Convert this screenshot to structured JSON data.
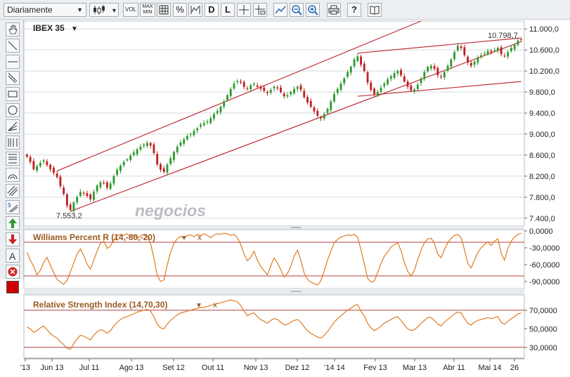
{
  "toolbar": {
    "period": "Diariamente",
    "vol_label": "VOL",
    "max_label": "MAX",
    "min_label": "MIN",
    "pct_label": "%",
    "d_label": "D",
    "l_label": "L",
    "help_label": "?"
  },
  "main_chart": {
    "title": "IBEX 35",
    "title_arrow": "▼",
    "watermark": "negocios",
    "last_value_label": "10.798,7",
    "low_value_label": "7.553,2",
    "y_tick_labels": [
      "11.000,0",
      "10.600,0",
      "10.200,0",
      "9.800,0",
      "9.400,0",
      "9.000,0",
      "8.600,0",
      "8.200,0",
      "7.800,0",
      "7.400,0"
    ],
    "x_tick_labels": [
      "'13",
      "Jun 13",
      "Jul 11",
      "Ago 13",
      "Set 12",
      "Out 11",
      "Nov 13",
      "Dez 12",
      "'14 14",
      "Fev 13",
      "Mar 13",
      "Abr 11",
      "Mai 14",
      "26"
    ],
    "colors": {
      "up": "#2e9a2e",
      "down": "#c02020",
      "channel": "#c0303a",
      "grid": "#d7dbe0",
      "text": "#222222"
    }
  },
  "chart_data": [
    {
      "type": "candlestick",
      "title": "IBEX 35",
      "ylim": [
        7250,
        11150
      ],
      "y_ticks": [
        11000,
        10600,
        10200,
        9800,
        9400,
        9000,
        8600,
        8200,
        7800,
        7400
      ],
      "x_ticks": [
        "'13",
        "Jun 13",
        "Jul 11",
        "Ago 13",
        "Set 12",
        "Out 11",
        "Nov 13",
        "Dez 12",
        "'14 14",
        "Fev 13",
        "Mar 13",
        "Abr 11",
        "Mai 14",
        "26"
      ],
      "grid": true,
      "annotations": [
        {
          "text": "10.798,7",
          "note": "last close"
        },
        {
          "text": "7.553,2",
          "note": "period low"
        }
      ],
      "close": [
        8570,
        8470,
        8330,
        8390,
        8450,
        8500,
        8410,
        8330,
        8260,
        8180,
        8010,
        7860,
        7640,
        7560,
        7700,
        7800,
        7900,
        7870,
        7820,
        7760,
        7900,
        8020,
        8080,
        8060,
        7980,
        8060,
        8200,
        8320,
        8400,
        8470,
        8520,
        8590,
        8650,
        8710,
        8760,
        8800,
        8830,
        8780,
        8640,
        8420,
        8320,
        8280,
        8420,
        8540,
        8660,
        8760,
        8840,
        8900,
        8960,
        9000,
        9060,
        9110,
        9180,
        9210,
        9240,
        9300,
        9380,
        9440,
        9520,
        9620,
        9740,
        9860,
        9960,
        10010,
        9980,
        9900,
        9860,
        9930,
        9950,
        9900,
        9860,
        9820,
        9780,
        9840,
        9900,
        9870,
        9800,
        9720,
        9740,
        9800,
        9860,
        9900,
        9840,
        9700,
        9600,
        9520,
        9430,
        9350,
        9300,
        9380,
        9480,
        9620,
        9760,
        9860,
        9960,
        10060,
        10180,
        10280,
        10420,
        10480,
        10320,
        10200,
        9980,
        9840,
        9760,
        9800,
        9880,
        9960,
        10040,
        10100,
        10160,
        10200,
        10120,
        10000,
        9900,
        9830,
        9850,
        9940,
        10060,
        10180,
        10280,
        10300,
        10240,
        10120,
        10080,
        10180,
        10300,
        10420,
        10560,
        10680,
        10640,
        10500,
        10360,
        10300,
        10380,
        10460,
        10500,
        10540,
        10580,
        10560,
        10600,
        10640,
        10520,
        10480,
        10560,
        10640,
        10700,
        10780,
        10799
      ]
    },
    {
      "type": "line",
      "title": "Williams Percent R (14,-80,-20)",
      "ylim": [
        -100,
        0
      ],
      "y_ticks": [
        0,
        -30,
        -60,
        -90
      ],
      "y_tick_labels": [
        "0,0000",
        "-30,0000",
        "-60,0000",
        "-90,0000"
      ],
      "levels": [
        -20,
        -80
      ],
      "values": [
        -38,
        -52,
        -63,
        -78,
        -70,
        -56,
        -47,
        -61,
        -74,
        -86,
        -91,
        -95,
        -88,
        -73,
        -57,
        -41,
        -32,
        -44,
        -59,
        -68,
        -52,
        -36,
        -22,
        -18,
        -31,
        -27,
        -15,
        -9,
        -6,
        -8,
        -5,
        -11,
        -7,
        -13,
        -9,
        -6,
        -10,
        -22,
        -48,
        -79,
        -90,
        -87,
        -61,
        -38,
        -22,
        -14,
        -10,
        -12,
        -8,
        -7,
        -10,
        -6,
        -9,
        -5,
        -8,
        -12,
        -7,
        -5,
        -6,
        -4,
        -5,
        -8,
        -6,
        -12,
        -24,
        -41,
        -53,
        -47,
        -36,
        -52,
        -63,
        -71,
        -78,
        -62,
        -48,
        -57,
        -69,
        -82,
        -76,
        -63,
        -45,
        -34,
        -52,
        -75,
        -86,
        -91,
        -94,
        -96,
        -89,
        -71,
        -52,
        -36,
        -21,
        -15,
        -11,
        -9,
        -7,
        -8,
        -6,
        -11,
        -33,
        -58,
        -84,
        -91,
        -89,
        -74,
        -58,
        -45,
        -37,
        -29,
        -24,
        -21,
        -35,
        -56,
        -72,
        -80,
        -70,
        -51,
        -34,
        -21,
        -14,
        -13,
        -22,
        -41,
        -48,
        -33,
        -21,
        -13,
        -8,
        -6,
        -12,
        -33,
        -58,
        -66,
        -52,
        -38,
        -30,
        -24,
        -19,
        -26,
        -18,
        -14,
        -40,
        -52,
        -31,
        -18,
        -11,
        -6,
        -4
      ]
    },
    {
      "type": "line",
      "title": "Relative Strength Index (14,70,30)",
      "ylim": [
        20,
        85
      ],
      "y_ticks": [
        70,
        50,
        30
      ],
      "y_tick_labels": [
        "70,0000",
        "50,0000",
        "30,0000"
      ],
      "levels": [
        70,
        30
      ],
      "values": [
        52,
        50,
        46,
        48,
        51,
        53,
        49,
        45,
        42,
        40,
        36,
        33,
        29,
        28,
        34,
        39,
        43,
        42,
        40,
        38,
        43,
        47,
        49,
        48,
        45,
        48,
        53,
        57,
        60,
        62,
        63,
        65,
        66,
        68,
        69,
        70,
        71,
        69,
        63,
        55,
        51,
        50,
        55,
        59,
        62,
        65,
        67,
        68,
        69,
        70,
        71,
        72,
        73,
        73,
        74,
        75,
        76,
        77,
        78,
        79,
        80,
        81,
        80,
        79,
        75,
        69,
        64,
        66,
        67,
        63,
        60,
        58,
        56,
        59,
        61,
        60,
        57,
        54,
        55,
        57,
        59,
        60,
        57,
        52,
        48,
        45,
        43,
        41,
        40,
        43,
        47,
        52,
        57,
        61,
        64,
        67,
        70,
        72,
        75,
        76,
        69,
        64,
        56,
        51,
        48,
        50,
        53,
        56,
        58,
        60,
        62,
        63,
        59,
        54,
        50,
        48,
        49,
        52,
        56,
        59,
        62,
        62,
        59,
        55,
        53,
        57,
        60,
        63,
        66,
        68,
        67,
        61,
        56,
        54,
        57,
        59,
        60,
        61,
        62,
        61,
        62,
        63,
        57,
        55,
        58,
        61,
        63,
        66,
        67
      ]
    }
  ],
  "williams_panel": {
    "title": "Williams Percent R (14,-80,-20)",
    "title_arrow": "▼",
    "close_label": "x",
    "y_tick_labels": [
      "0,0000",
      "-30,0000",
      "-60,0000",
      "-90,0000"
    ]
  },
  "rsi_panel": {
    "title": "Relative Strength Index (14,70,30)",
    "title_arrow": "▼",
    "close_label": "x",
    "y_tick_labels": [
      "70,0000",
      "50,0000",
      "30,0000"
    ]
  }
}
